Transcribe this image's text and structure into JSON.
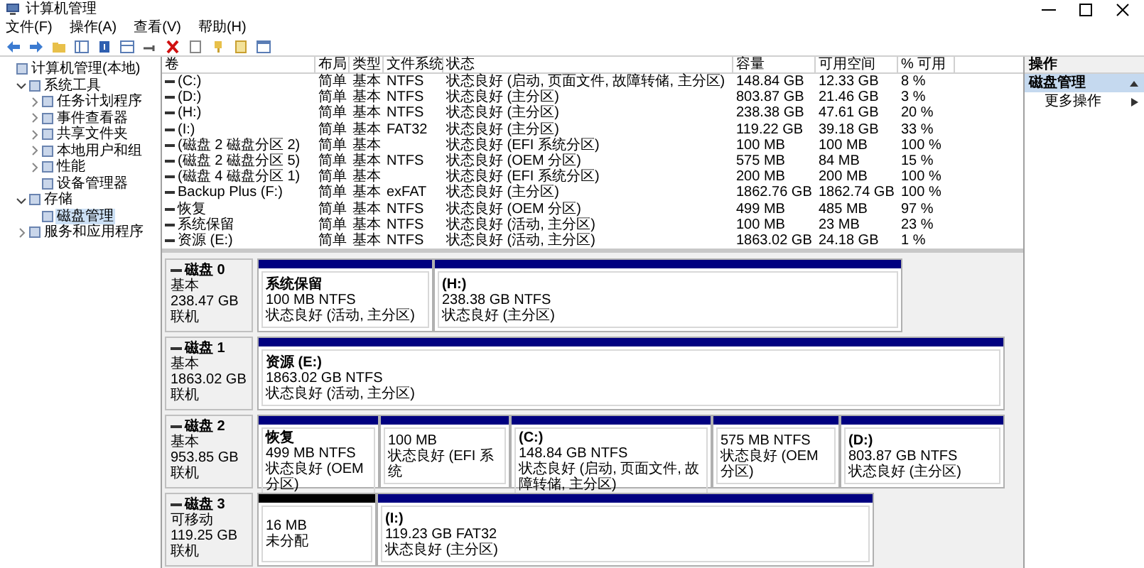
{
  "window": {
    "title": "计算机管理"
  },
  "menu": [
    "文件(F)",
    "操作(A)",
    "查看(V)",
    "帮助(H)"
  ],
  "tree": [
    {
      "label": "计算机管理(本地)",
      "expandable": false,
      "selected": false,
      "children": [
        {
          "label": "系统工具",
          "expandable": true,
          "expanded": true,
          "selected": false,
          "children": [
            {
              "label": "任务计划程序",
              "expandable": true,
              "expanded": false,
              "selected": false
            },
            {
              "label": "事件查看器",
              "expandable": true,
              "expanded": false,
              "selected": false
            },
            {
              "label": "共享文件夹",
              "expandable": true,
              "expanded": false,
              "selected": false
            },
            {
              "label": "本地用户和组",
              "expandable": true,
              "expanded": false,
              "selected": false
            },
            {
              "label": "性能",
              "expandable": true,
              "expanded": false,
              "selected": false
            },
            {
              "label": "设备管理器",
              "expandable": false,
              "expanded": false,
              "selected": false
            }
          ]
        },
        {
          "label": "存储",
          "expandable": true,
          "expanded": true,
          "selected": false,
          "children": [
            {
              "label": "磁盘管理",
              "expandable": false,
              "expanded": false,
              "selected": true
            }
          ]
        },
        {
          "label": "服务和应用程序",
          "expandable": true,
          "expanded": false,
          "selected": false
        }
      ]
    }
  ],
  "table": {
    "columns": [
      "卷",
      "布局",
      "类型",
      "文件系统",
      "状态",
      "容量",
      "可用空间",
      "% 可用"
    ],
    "rows": [
      {
        "volume": "(C:)",
        "layout": "简单",
        "type": "基本",
        "file_system": "NTFS",
        "status": "状态良好 (启动, 页面文件, 故障转储, 主分区)",
        "capacity": "148.84 GB",
        "free_space": "12.33 GB",
        "percent_free": "8 %"
      },
      {
        "volume": "(D:)",
        "layout": "简单",
        "type": "基本",
        "file_system": "NTFS",
        "status": "状态良好 (主分区)",
        "capacity": "803.87 GB",
        "free_space": "21.46 GB",
        "percent_free": "3 %"
      },
      {
        "volume": "(H:)",
        "layout": "简单",
        "type": "基本",
        "file_system": "NTFS",
        "status": "状态良好 (主分区)",
        "capacity": "238.38 GB",
        "free_space": "47.61 GB",
        "percent_free": "20 %"
      },
      {
        "volume": "(I:)",
        "layout": "简单",
        "type": "基本",
        "file_system": "FAT32",
        "status": "状态良好 (主分区)",
        "capacity": "119.22 GB",
        "free_space": "39.18 GB",
        "percent_free": "33 %"
      },
      {
        "volume": "(磁盘 2 磁盘分区 2)",
        "layout": "简单",
        "type": "基本",
        "status": "状态良好 (EFI 系统分区)",
        "capacity": "100 MB",
        "free_space": "100 MB",
        "percent_free": "100 %"
      },
      {
        "volume": "(磁盘 2 磁盘分区 5)",
        "layout": "简单",
        "type": "基本",
        "file_system": "NTFS",
        "status": "状态良好 (OEM 分区)",
        "capacity": "575 MB",
        "free_space": "84 MB",
        "percent_free": "15 %"
      },
      {
        "volume": "(磁盘 4 磁盘分区 1)",
        "layout": "简单",
        "type": "基本",
        "status": "状态良好 (EFI 系统分区)",
        "capacity": "200 MB",
        "free_space": "200 MB",
        "percent_free": "100 %"
      },
      {
        "volume": "Backup Plus (F:)",
        "layout": "简单",
        "type": "基本",
        "file_system": "exFAT",
        "status": "状态良好 (主分区)",
        "capacity": "1862.76 GB",
        "free_space": "1862.74 GB",
        "percent_free": "100 %"
      },
      {
        "volume": "恢复",
        "layout": "简单",
        "type": "基本",
        "file_system": "NTFS",
        "status": "状态良好 (OEM 分区)",
        "capacity": "499 MB",
        "free_space": "485 MB",
        "percent_free": "97 %"
      },
      {
        "volume": "系统保留",
        "layout": "简单",
        "type": "基本",
        "file_system": "NTFS",
        "status": "状态良好 (活动, 主分区)",
        "capacity": "100 MB",
        "free_space": "23 MB",
        "percent_free": "23 %"
      },
      {
        "volume": "资源 (E:)",
        "layout": "简单",
        "type": "基本",
        "file_system": "NTFS",
        "status": "状态良好 (活动, 主分区)",
        "capacity": "1863.02 GB",
        "free_space": "24.18 GB",
        "percent_free": "1 %"
      }
    ]
  },
  "disks": [
    {
      "name": "磁盘 0",
      "type": "基本",
      "size": "238.47 GB",
      "state": "联机",
      "partitions": [
        {
          "kind": "primary",
          "name": "系统保留",
          "size": "100 MB NTFS",
          "status": "状态良好 (活动, 主分区)"
        },
        {
          "kind": "primary",
          "name": "(H:)",
          "size": "238.38 GB NTFS",
          "status": "状态良好 (主分区)"
        }
      ]
    },
    {
      "name": "磁盘 1",
      "type": "基本",
      "size": "1863.02 GB",
      "state": "联机",
      "partitions": [
        {
          "kind": "primary",
          "name": "资源 (E:)",
          "size": "1863.02 GB NTFS",
          "status": "状态良好 (活动, 主分区)"
        }
      ]
    },
    {
      "name": "磁盘 2",
      "type": "基本",
      "size": "953.85 GB",
      "state": "联机",
      "partitions": [
        {
          "kind": "primary",
          "name": "恢复",
          "size": "499 MB NTFS",
          "status": "状态良好 (OEM 分区)"
        },
        {
          "kind": "primary",
          "size": "100 MB",
          "status": "状态良好 (EFI 系统"
        },
        {
          "kind": "primary",
          "name": "(C:)",
          "size": "148.84 GB NTFS",
          "status": "状态良好 (启动, 页面文件, 故障转储, 主分区)"
        },
        {
          "kind": "primary",
          "size": "575 MB NTFS",
          "status": "状态良好 (OEM 分区)"
        },
        {
          "kind": "primary",
          "name": "(D:)",
          "size": "803.87 GB NTFS",
          "status": "状态良好 (主分区)"
        }
      ]
    },
    {
      "name": "磁盘 3",
      "type": "可移动",
      "size": "119.25 GB",
      "state": "联机",
      "partitions": [
        {
          "kind": "unallocated",
          "size": "16 MB",
          "status": "未分配"
        },
        {
          "kind": "primary",
          "name": "(I:)",
          "size": "119.23 GB FAT32",
          "status": "状态良好 (主分区)"
        }
      ]
    }
  ],
  "actions": {
    "header": "操作",
    "items": [
      {
        "label": "磁盘管理",
        "selected": true
      },
      {
        "label": "更多操作",
        "selected": false
      }
    ]
  }
}
